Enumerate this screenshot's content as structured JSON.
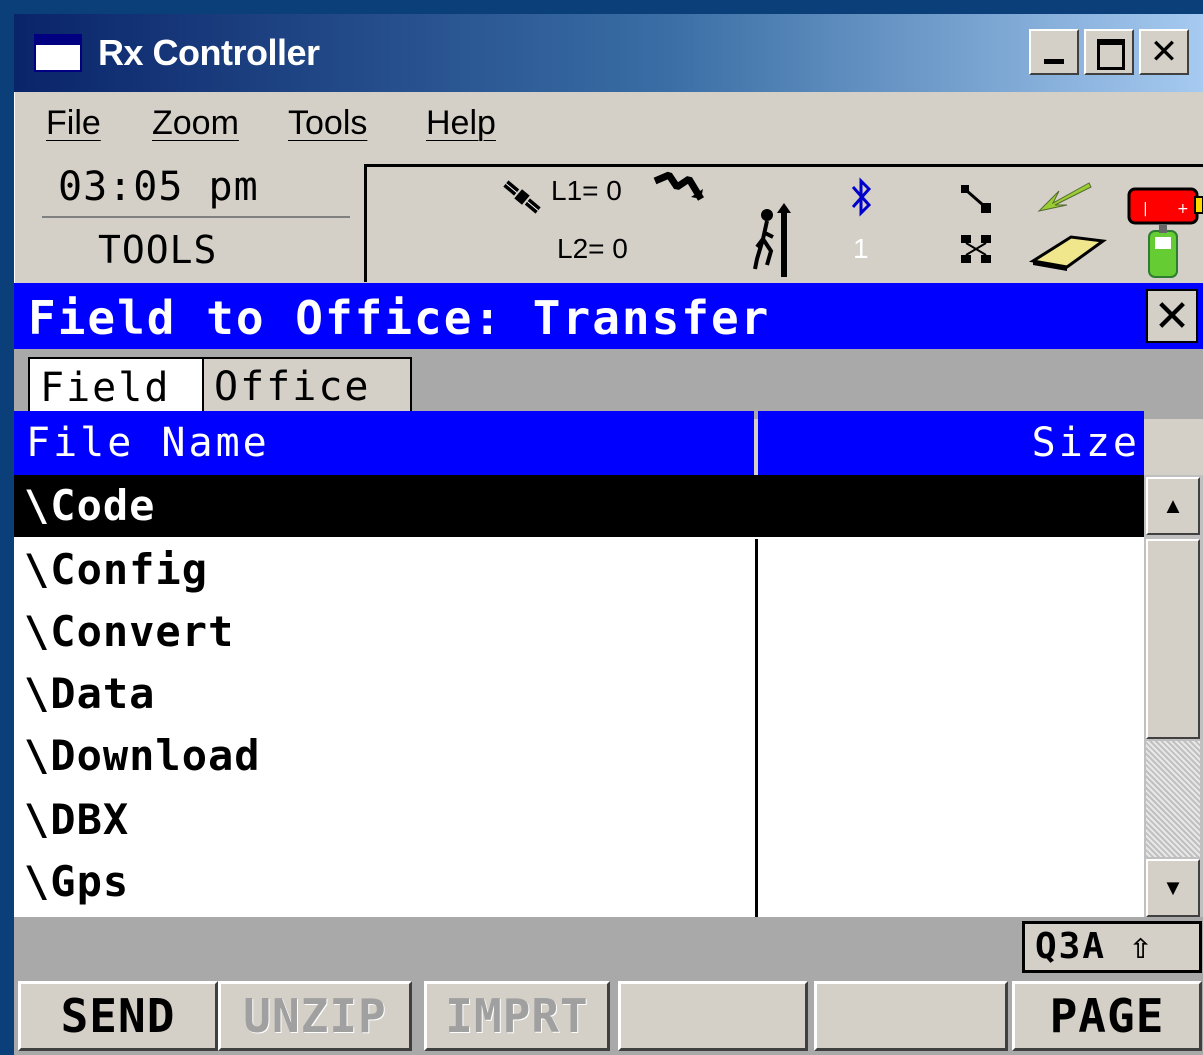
{
  "window": {
    "title": "Rx Controller",
    "buttons": {
      "minimize": "minimize",
      "maximize": "maximize",
      "close": "✕"
    }
  },
  "menu": {
    "items": [
      {
        "label": "File"
      },
      {
        "label": "Zoom"
      },
      {
        "label": "Tools"
      },
      {
        "label": "Help"
      }
    ]
  },
  "status": {
    "time": "03:05 pm",
    "mode": "TOOLS",
    "l1": "L1= 0",
    "l2": "L2= 0",
    "bluetooth_count": "1",
    "icons": [
      "satellite-icon",
      "signal-icon",
      "antenna-height-icon",
      "bluetooth-icon",
      "link-icon",
      "network-icon",
      "arrow-icon",
      "card-icon",
      "battery-icon",
      "controller-icon"
    ],
    "colors": {
      "battery": "#ff0000",
      "arrow": "#9acd32",
      "card": "#f0e68c",
      "controller": "#66cc33"
    }
  },
  "dialog": {
    "title": "Field to Office: Transfer",
    "close_label": "✕",
    "tabs": [
      {
        "label": "Field",
        "active": true
      },
      {
        "label": "Office",
        "active": false
      }
    ],
    "columns": {
      "name": "File Name",
      "size": "Size"
    },
    "rows": [
      {
        "name": "\\Code",
        "size": "",
        "selected": true
      },
      {
        "name": "\\Config",
        "size": ""
      },
      {
        "name": "\\Convert",
        "size": ""
      },
      {
        "name": "\\Data",
        "size": ""
      },
      {
        "name": "\\Download",
        "size": ""
      },
      {
        "name": "\\DBX",
        "size": ""
      },
      {
        "name": "\\Gps",
        "size": ""
      }
    ],
    "input_mode": "Q3A ⇧",
    "softkeys": [
      {
        "label": "SEND",
        "enabled": true
      },
      {
        "label": "UNZIP",
        "enabled": false
      },
      {
        "label": "IMPRT",
        "enabled": false
      },
      {
        "label": "",
        "enabled": true
      },
      {
        "label": "",
        "enabled": true
      },
      {
        "label": "PAGE",
        "enabled": true
      }
    ]
  },
  "colors": {
    "title_bar": "#0a246a",
    "dialog_title": "#0000ff",
    "selection": "#000000"
  }
}
